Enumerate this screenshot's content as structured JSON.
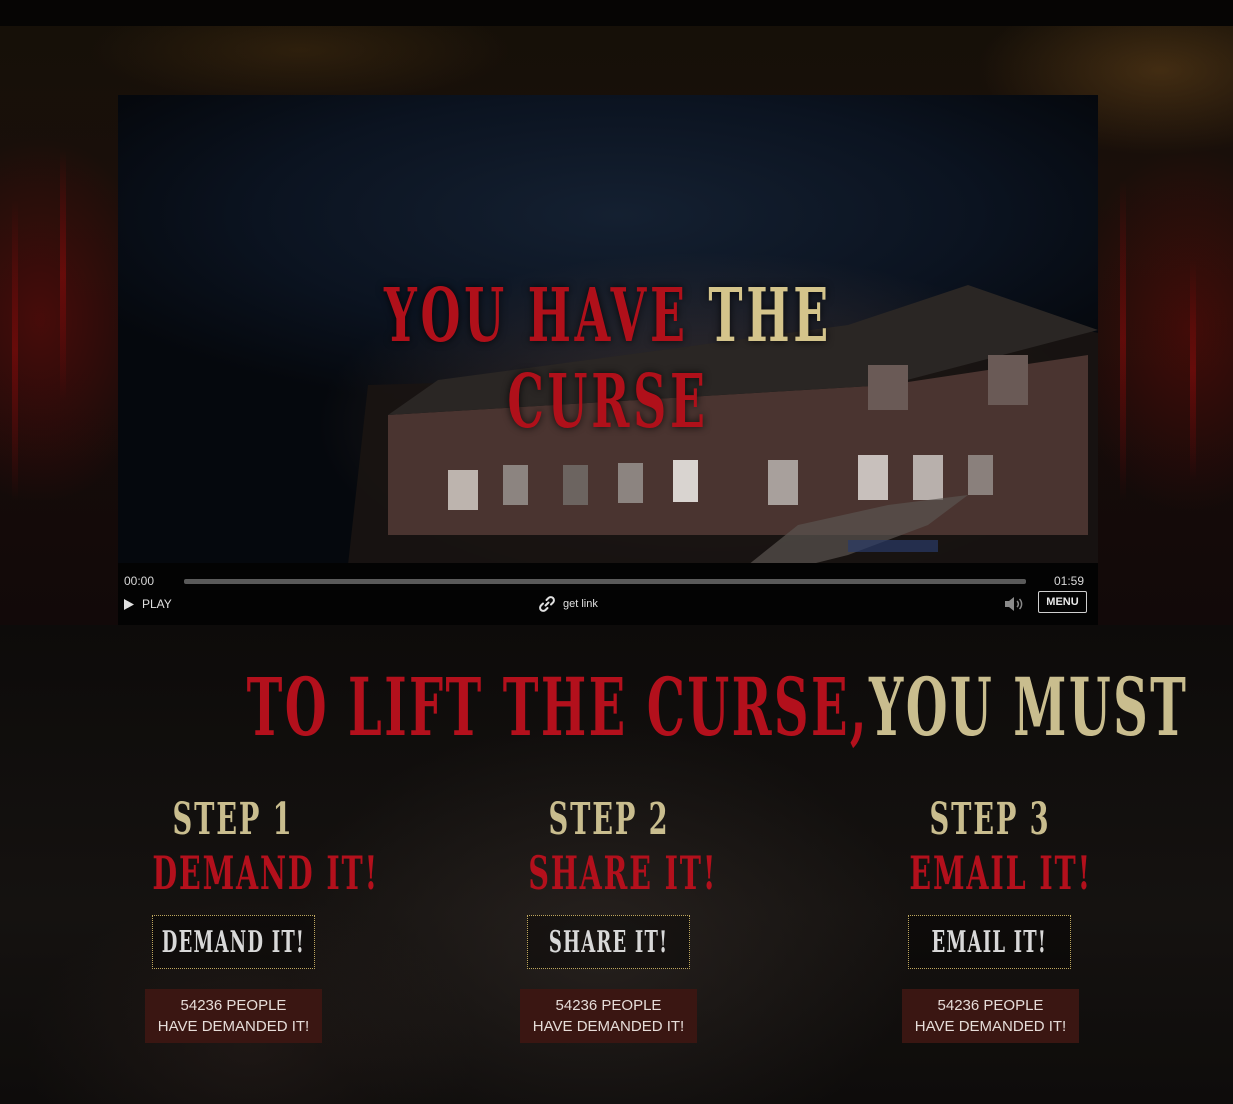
{
  "video": {
    "title_red_1": "YOU HAVE",
    "title_tan": "THE",
    "title_red_2": "CURSE",
    "current_time": "00:00",
    "duration": "01:59",
    "progress": 0,
    "play_label": "PLAY",
    "get_link_label": "get link",
    "menu_label": "MENU"
  },
  "main": {
    "heading_red": "TO LIFT THE CURSE,",
    "heading_tan": "YOU MUST"
  },
  "steps": [
    {
      "number": "STEP 1",
      "action": "DEMAND IT!",
      "button": "DEMAND IT!",
      "count_line1": "54236 PEOPLE",
      "count_line2": "HAVE DEMANDED IT!"
    },
    {
      "number": "STEP 2",
      "action": "SHARE IT!",
      "button": "SHARE IT!",
      "count_line1": "54236 PEOPLE",
      "count_line2": "HAVE DEMANDED IT!"
    },
    {
      "number": "STEP 3",
      "action": "EMAIL IT!",
      "button": "EMAIL IT!",
      "count_line1": "54236 PEOPLE",
      "count_line2": "HAVE DEMANDED IT!"
    }
  ],
  "colors": {
    "blood_red": "#b3101c",
    "bone_tan": "#c9bd8e",
    "counter_bg": "#3a1612"
  }
}
